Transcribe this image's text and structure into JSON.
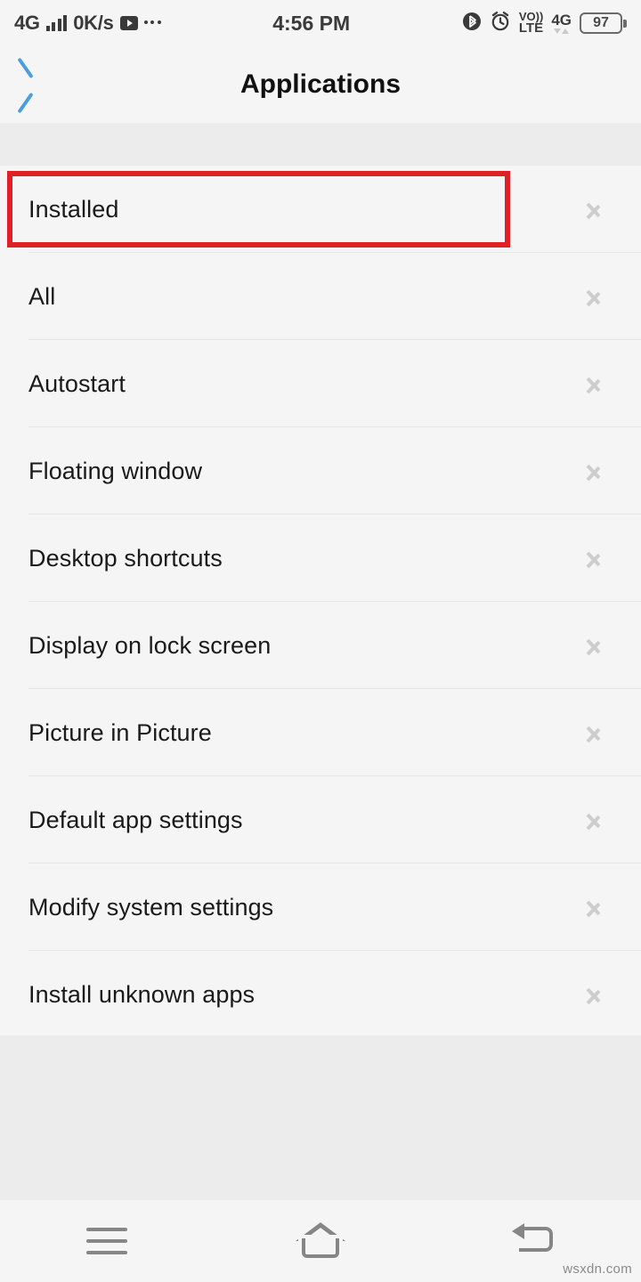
{
  "status_bar": {
    "network_label": "4G",
    "signal_icon": "signal-bars-icon",
    "data_rate": "0K/s",
    "media_icon": "play-icon",
    "overflow_icon": "more-dots-icon",
    "time": "4:56 PM",
    "bluetooth_icon": "bluetooth-icon",
    "alarm_icon": "alarm-clock-icon",
    "volte_top": "VO))",
    "volte_bottom": "LTE",
    "network_right_label": "4G",
    "battery_level": "97",
    "battery_icon": "battery-icon"
  },
  "header": {
    "back_icon": "back-chevron-icon",
    "title": "Applications"
  },
  "list": {
    "items": [
      {
        "label": "Installed",
        "chevron": "chevron-right-icon",
        "highlighted": true
      },
      {
        "label": "All",
        "chevron": "chevron-right-icon",
        "highlighted": false
      },
      {
        "label": "Autostart",
        "chevron": "chevron-right-icon",
        "highlighted": false
      },
      {
        "label": "Floating window",
        "chevron": "chevron-right-icon",
        "highlighted": false
      },
      {
        "label": "Desktop shortcuts",
        "chevron": "chevron-right-icon",
        "highlighted": false
      },
      {
        "label": "Display on lock screen",
        "chevron": "chevron-right-icon",
        "highlighted": false
      },
      {
        "label": "Picture in Picture",
        "chevron": "chevron-right-icon",
        "highlighted": false
      },
      {
        "label": "Default app settings",
        "chevron": "chevron-right-icon",
        "highlighted": false
      },
      {
        "label": "Modify system settings",
        "chevron": "chevron-right-icon",
        "highlighted": false
      },
      {
        "label": "Install unknown apps",
        "chevron": "chevron-right-icon",
        "highlighted": false
      }
    ],
    "highlight_color": "#e01f26"
  },
  "nav_bar": {
    "menu_icon": "menu-icon",
    "home_icon": "home-icon",
    "back_icon": "back-icon"
  },
  "watermark": {
    "text": "wsxdn.com"
  },
  "colors": {
    "accent_blue": "#4a9edd",
    "highlight_red": "#e01f26",
    "surface": "#f5f5f5",
    "background": "#ececec",
    "divider": "#e6e6e6",
    "chevron_gray": "#cdcdcd"
  }
}
